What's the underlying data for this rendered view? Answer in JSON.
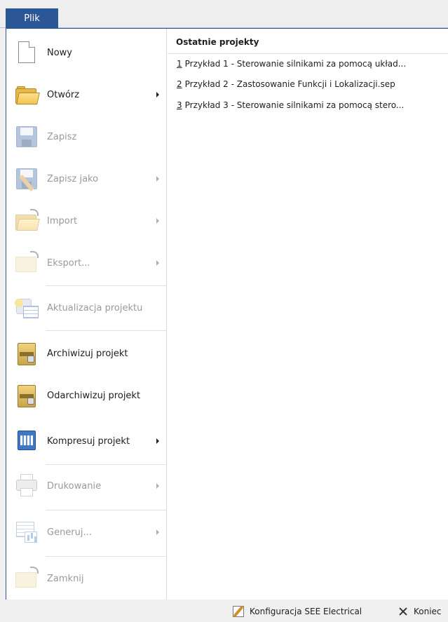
{
  "ribbon": {
    "file_tab": "Plik"
  },
  "menu": {
    "items": [
      {
        "label": "Nowy",
        "enabled": true,
        "submenu": false,
        "icon": "new-document-icon"
      },
      {
        "label": "Otwórz",
        "enabled": true,
        "submenu": true,
        "icon": "open-folder-icon"
      },
      {
        "label": "Zapisz",
        "enabled": false,
        "submenu": false,
        "icon": "save-disk-icon"
      },
      {
        "label": "Zapisz jako",
        "enabled": false,
        "submenu": true,
        "icon": "save-as-icon"
      },
      {
        "label": "Import",
        "enabled": false,
        "submenu": true,
        "icon": "import-folder-icon"
      },
      {
        "label": "Eksport...",
        "enabled": false,
        "submenu": true,
        "icon": "export-folder-icon"
      },
      {
        "label": "Aktualizacja projektu",
        "enabled": false,
        "submenu": false,
        "icon": "update-project-icon"
      },
      {
        "label": "Archiwizuj projekt",
        "enabled": true,
        "submenu": false,
        "icon": "archive-icon"
      },
      {
        "label": "Odarchiwizuj projekt",
        "enabled": true,
        "submenu": false,
        "icon": "unarchive-icon"
      },
      {
        "label": "Kompresuj projekt",
        "enabled": true,
        "submenu": true,
        "icon": "compress-icon"
      },
      {
        "label": "Drukowanie",
        "enabled": false,
        "submenu": true,
        "icon": "printer-icon"
      },
      {
        "label": "Generuj...",
        "enabled": false,
        "submenu": true,
        "icon": "generate-icon"
      },
      {
        "label": "Zamknij",
        "enabled": false,
        "submenu": false,
        "icon": "close-folder-icon"
      }
    ]
  },
  "recent": {
    "title": "Ostatnie projekty",
    "items": [
      {
        "num": "1",
        "label": "Przykład 1 - Sterowanie silnikami za pomocą układ..."
      },
      {
        "num": "2",
        "label": "Przykład 2 - Zastosowanie Funkcji i Lokalizacji.sep"
      },
      {
        "num": "3",
        "label": "Przykład 3 - Sterowanie silnikami za pomocą stero..."
      }
    ]
  },
  "footer": {
    "config_label": "Konfiguracja SEE Electrical",
    "exit_label": "Koniec"
  }
}
